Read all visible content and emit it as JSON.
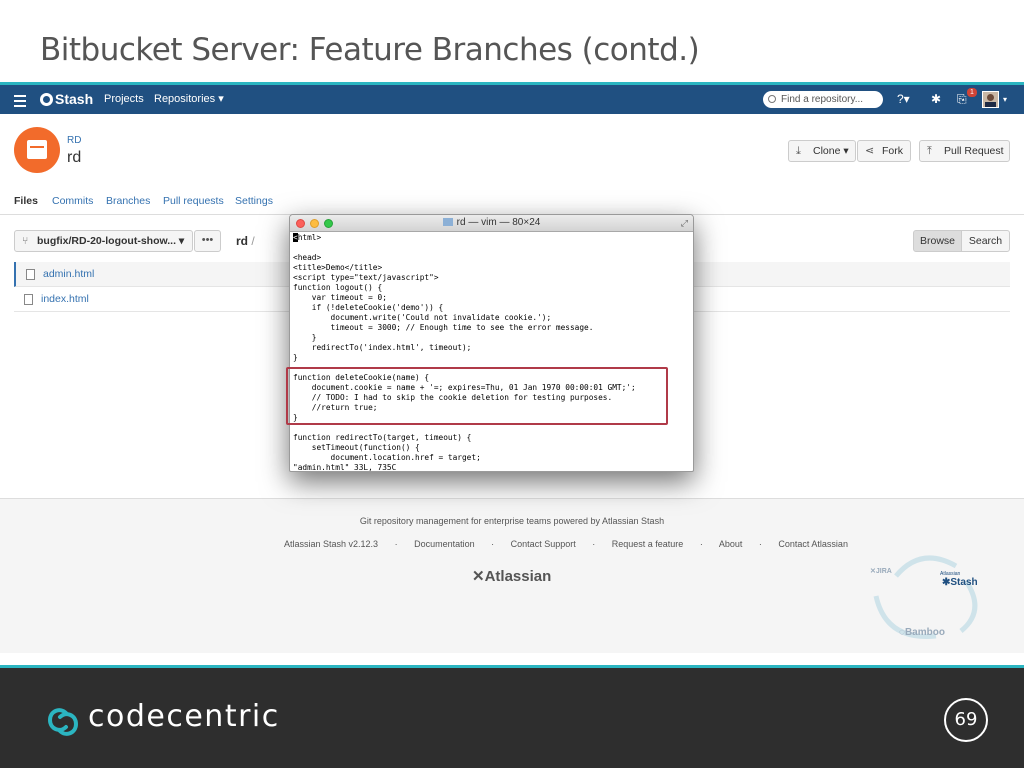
{
  "slide": {
    "title": "Bitbucket Server: Feature Branches (contd.)",
    "brand": "codecentric",
    "page_number": "69",
    "accent_color": "#2bb5c1"
  },
  "stash_nav": {
    "logo": "Stash",
    "projects": "Projects",
    "repositories": "Repositories",
    "search_placeholder": "Find a repository...",
    "notification_count": "1",
    "icons": [
      "hamburger-icon",
      "help-icon",
      "gear-icon",
      "inbox-icon",
      "avatar"
    ]
  },
  "repo": {
    "project": "RD",
    "name": "rd",
    "clone": "Clone",
    "fork": "Fork",
    "pull_request": "Pull Request"
  },
  "tabs": [
    {
      "label": "Files",
      "active": true
    },
    {
      "label": "Commits"
    },
    {
      "label": "Branches"
    },
    {
      "label": "Pull requests"
    },
    {
      "label": "Settings"
    }
  ],
  "browser": {
    "branch": "bugfix/RD-20-logout-show...",
    "more": "•••",
    "path_root": "rd",
    "path_sep": "/",
    "browse": "Browse",
    "search": "Search",
    "files": [
      "admin.html",
      "index.html"
    ]
  },
  "vim": {
    "title": "rd — vim — 80×24",
    "first_char": "<",
    "code_rest": "html>\n\n<head>\n<title>Demo</title>\n<script type=\"text/javascript\">\nfunction logout() {\n    var timeout = 0;\n    if (!deleteCookie('demo')) {\n        document.write('Could not invalidate cookie.');\n        timeout = 3000; // Enough time to see the error message.\n    }\n    redirectTo('index.html', timeout);\n}\n\nfunction deleteCookie(name) {\n    document.cookie = name + '=; expires=Thu, 01 Jan 1970 00:00:01 GMT;';\n    // TODO: I had to skip the cookie deletion for testing purposes.\n    //return true;\n}\n\nfunction redirectTo(target, timeout) {\n    setTimeout(function() {\n        document.location.href = target;\n\"admin.html\" 33L, 735C"
  },
  "stash_footer": {
    "tagline": "Git repository management for enterprise teams powered by Atlassian Stash",
    "links": [
      "Atlassian Stash v2.12.3",
      "·",
      "Documentation",
      "·",
      "Contact Support",
      "·",
      "Request a feature",
      "·",
      "About",
      "·",
      "Contact Atlassian"
    ],
    "atlassian": "Atlassian",
    "cycle": {
      "jira": "JIRA",
      "stash": "Stash",
      "bamboo": "Bamboo",
      "small": "Atlassian"
    }
  }
}
